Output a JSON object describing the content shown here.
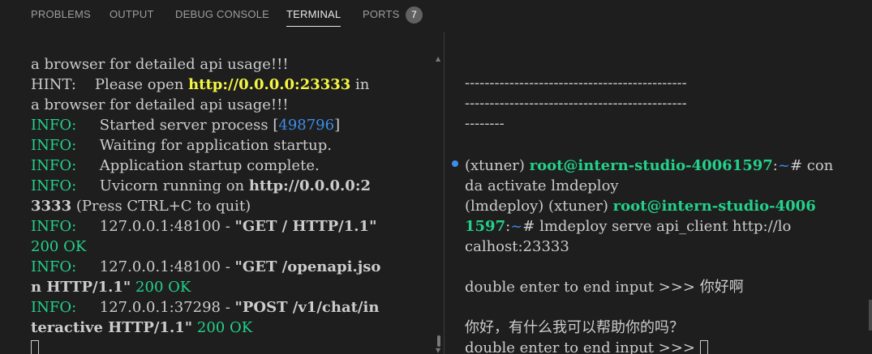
{
  "tabs": [
    {
      "label": "PROBLEMS"
    },
    {
      "label": "OUTPUT"
    },
    {
      "label": "DEBUG CONSOLE"
    },
    {
      "label": "TERMINAL"
    },
    {
      "label": "PORTS"
    }
  ],
  "ports_count": "7",
  "colors": {
    "green": "#23d18b",
    "yellow": "#f5f543",
    "blue": "#3b8eea",
    "text": "#cccccc",
    "background": "#1e1e1e"
  },
  "left_terminal": {
    "l1": "a browser for detailed api usage!!!",
    "l2_prefix": "HINT:    Please open ",
    "l2_url": "http://0.0.0.0:23333",
    "l2_suffix": " in",
    "l3": "a browser for detailed api usage!!!",
    "info": "INFO:",
    "l4_text": "     Started server process [",
    "l4_pid": "498796",
    "l4_end": "]",
    "l5_text": "     Waiting for application startup.",
    "l6_text": "     Application startup complete.",
    "l7_text": "     Uvicorn running on ",
    "l7_url": "http://0.0.0.0:2",
    "l8_url": "3333",
    "l8_text": " (Press CTRL+C to quit)",
    "l9_text": "     127.0.0.1:48100 - ",
    "l9_req": "\"GET / HTTP/1.1\"",
    "l10_status": "200 OK",
    "l11_text": "     127.0.0.1:48100 - ",
    "l11_req": "\"GET /openapi.jso",
    "l12_req": "n HTTP/1.1\"",
    "l12_status": " 200 OK",
    "l13_text": "     127.0.0.1:37298 - ",
    "l13_req": "\"POST /v1/chat/in",
    "l14_req": "teractive HTTP/1.1\"",
    "l14_status": " 200 OK"
  },
  "right_terminal": {
    "dash1": "---------------------------------------------",
    "dash2": "---------------------------------------------",
    "dash3": "--------",
    "p1_env": "(xtuner) ",
    "p1_user": "root@intern-studio-40061597",
    "p1_colon": ":",
    "p1_path": "~",
    "p1_cmd": "# con",
    "p1_cont": "da activate lmdeploy",
    "p2_env": "(lmdeploy) (xtuner) ",
    "p2_user": "root@intern-studio-4006",
    "p2_user_cont": "1597",
    "p2_colon": ":",
    "p2_path": "~",
    "p2_cmd": "# lmdeploy serve api_client http://lo",
    "p2_cont": "calhost:23333",
    "prompt1": "double enter to end input >>> 你好啊",
    "reply": "你好，有什么我可以帮助你的吗？",
    "prompt2": "double enter to end input >>> "
  }
}
